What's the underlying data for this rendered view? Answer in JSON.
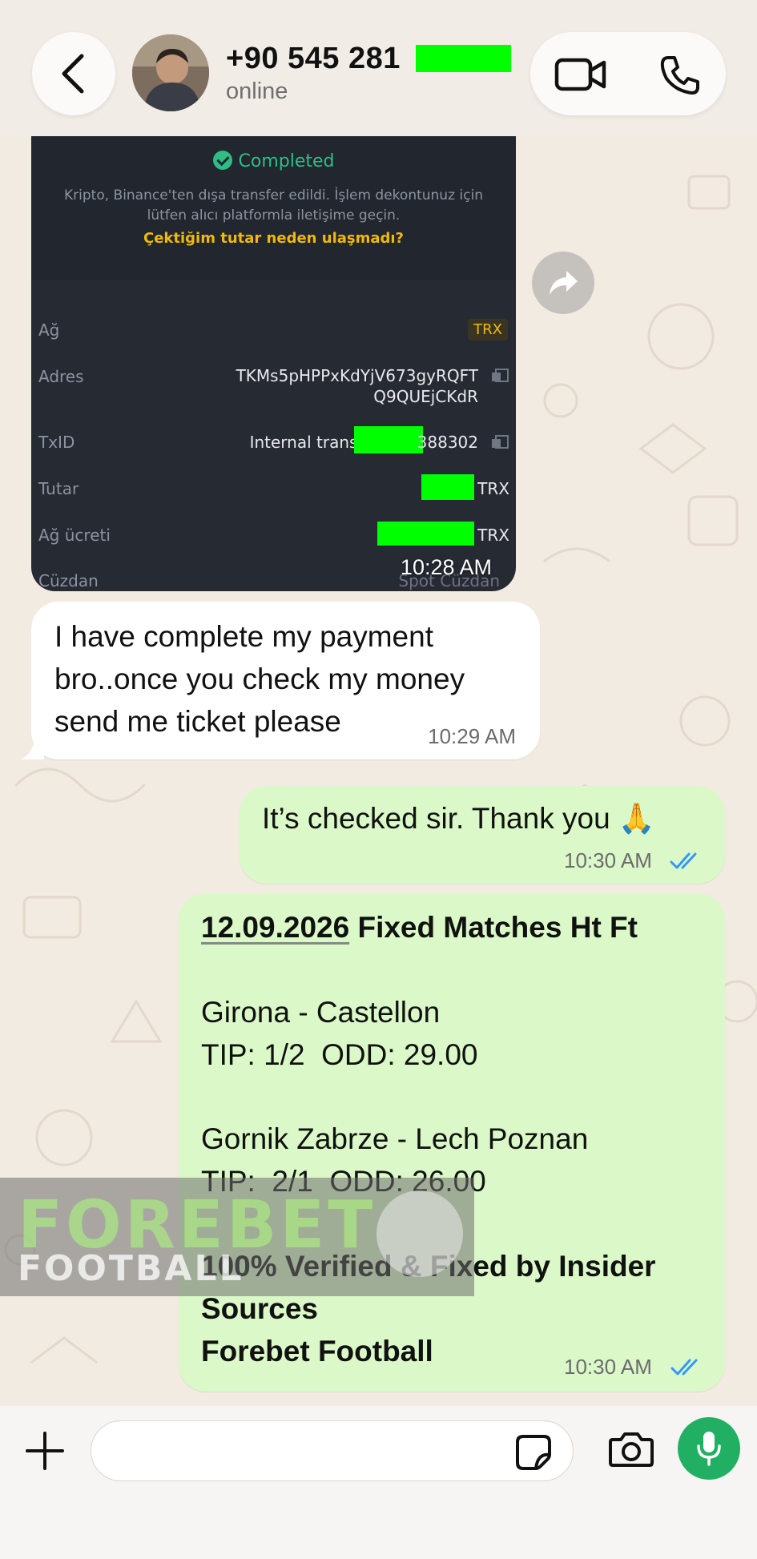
{
  "header": {
    "contact_name": "+90 545 281",
    "status": "online",
    "icons": [
      "chevron-left-icon",
      "video-camera-icon",
      "phone-icon"
    ]
  },
  "image_message": {
    "completed_label": "Completed",
    "note": "Kripto, Binance'ten dışa transfer edildi. İşlem dekontunuz için lütfen alıcı platformla iletişime geçin.",
    "link": "Çektiğim tutar neden ulaşmadı?",
    "rows": [
      {
        "label": "Ağ",
        "value": "TRX"
      },
      {
        "label": "Adres",
        "value": "TKMs5pHPPxKdYjV673gyRQFT\nQ9QUEjCKdR"
      },
      {
        "label": "TxID",
        "value_prefix": "Internal transfer",
        "value_suffix": "388302"
      },
      {
        "label": "Tutar",
        "unit": "TRX"
      },
      {
        "label": "Ağ ücreti",
        "unit": "TRX"
      },
      {
        "label": "Cüzdan",
        "value": "Spot Cüzdan"
      }
    ],
    "time": "10:28 AM"
  },
  "messages": [
    {
      "direction": "in",
      "text": "I have complete my payment\nbro..once you check my money\nsend me ticket please",
      "time": "10:29 AM"
    },
    {
      "direction": "out",
      "text": "It’s checked sir. Thank you 🙏",
      "time": "10:30 AM",
      "read": true
    },
    {
      "direction": "out",
      "date": "12.09.2026",
      "title": "Fixed Matches Ht Ft",
      "match1": "Girona - Castellon",
      "tip1": "TIP: 1/2  ODD: 29.00",
      "match2": "Gornik Zabrze - Lech Poznan",
      "tip2": "TIP:  2/1  ODD: 26.00",
      "footer1": "100% Verified & Fixed by Insider",
      "footer2": "Sources",
      "footer3": "Forebet Football",
      "time": "10:30 AM",
      "read": true
    }
  ],
  "watermark": {
    "line1": "FOREBET",
    "line2": "FOOTBALL"
  },
  "composer": {
    "placeholder": "",
    "value": ""
  },
  "colors": {
    "outgoing_bubble": "#dbf9c8",
    "incoming_bubble": "#ffffff",
    "read_ticks": "#3497f9",
    "mic_button": "#21b063",
    "redaction": "#00ff00"
  }
}
